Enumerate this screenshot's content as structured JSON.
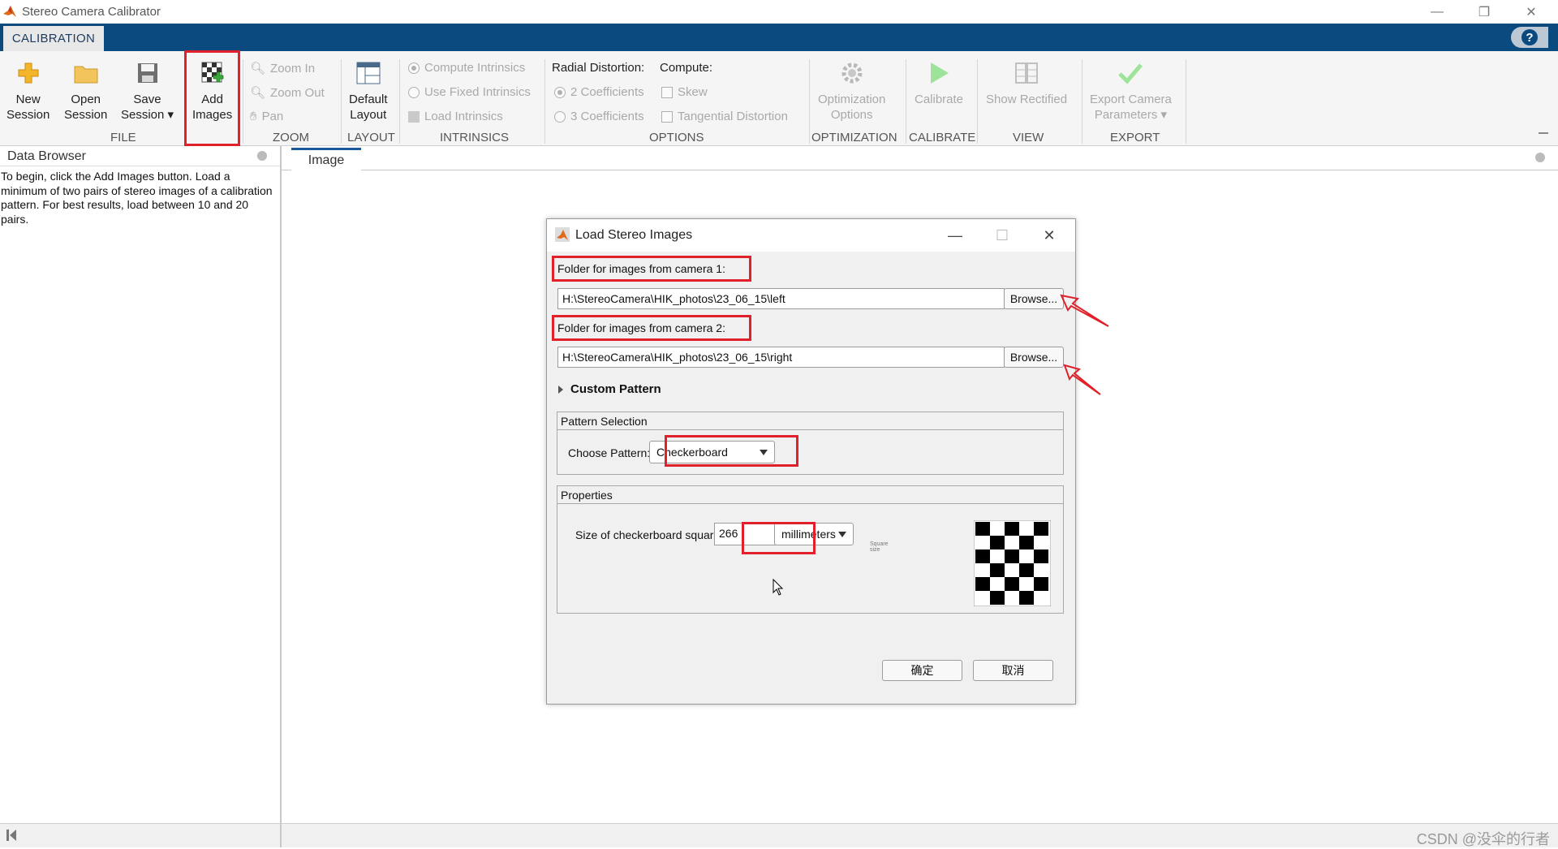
{
  "app": {
    "title": "Stereo Camera Calibrator",
    "tab": "CALIBRATION",
    "window_controls": {
      "minimize": "—",
      "restore": "❐",
      "close": "✕"
    },
    "help": "?"
  },
  "ribbon": {
    "file": {
      "label": "FILE",
      "new_session": [
        "New",
        "Session"
      ],
      "open_session": [
        "Open",
        "Session"
      ],
      "save_session": [
        "Save",
        "Session ▾"
      ],
      "add_images": [
        "Add",
        "Images"
      ]
    },
    "zoom": {
      "label": "ZOOM",
      "zoom_in": "Zoom In",
      "zoom_out": "Zoom Out",
      "pan": "Pan"
    },
    "layout": {
      "label": "LAYOUT",
      "default_layout": [
        "Default",
        "Layout"
      ]
    },
    "intrinsics": {
      "label": "INTRINSICS",
      "compute": "Compute Intrinsics",
      "use_fixed": "Use Fixed Intrinsics",
      "load": "Load Intrinsics"
    },
    "options": {
      "label": "OPTIONS",
      "radial_distortion": "Radial Distortion:",
      "compute": "Compute:",
      "two_coeff": "2 Coefficients",
      "three_coeff": "3 Coefficients",
      "skew": "Skew",
      "tangential": "Tangential Distortion"
    },
    "optimization": {
      "label": "OPTIMIZATION",
      "button": [
        "Optimization",
        "Options"
      ]
    },
    "calibrate": {
      "label": "CALIBRATE",
      "button": "Calibrate"
    },
    "view": {
      "label": "VIEW",
      "button": "Show Rectified"
    },
    "export": {
      "label": "EXPORT",
      "button": [
        "Export Camera",
        "Parameters ▾"
      ]
    }
  },
  "data_browser": {
    "title": "Data Browser",
    "text": "To begin, click the Add Images button. Load a minimum of two pairs of stereo images of a calibration pattern. For best results, load between 10 and 20 pairs."
  },
  "document": {
    "tab": "Image"
  },
  "dialog": {
    "title": "Load Stereo Images",
    "camera1_label": "Folder for images from camera 1:",
    "camera1_path": "H:\\StereoCamera\\HIK_photos\\23_06_15\\left",
    "camera2_label": "Folder for images from camera 2:",
    "camera2_path": "H:\\StereoCamera\\HIK_photos\\23_06_15\\right",
    "browse": "Browse...",
    "custom_pattern": "Custom Pattern",
    "pattern_selection": "Pattern Selection",
    "choose_pattern_label": "Choose Pattern:",
    "choose_pattern_value": "Checkerboard",
    "properties": "Properties",
    "square_size_label": "Size of checkerboard square:",
    "square_size_value": "266",
    "units": "millimeters",
    "preview_label": "Square size",
    "ok": "确定",
    "cancel": "取消"
  },
  "watermark": "CSDN @没伞的行者",
  "colors": {
    "accent": "#0a4a7f",
    "annotation_red": "#e0202a"
  }
}
